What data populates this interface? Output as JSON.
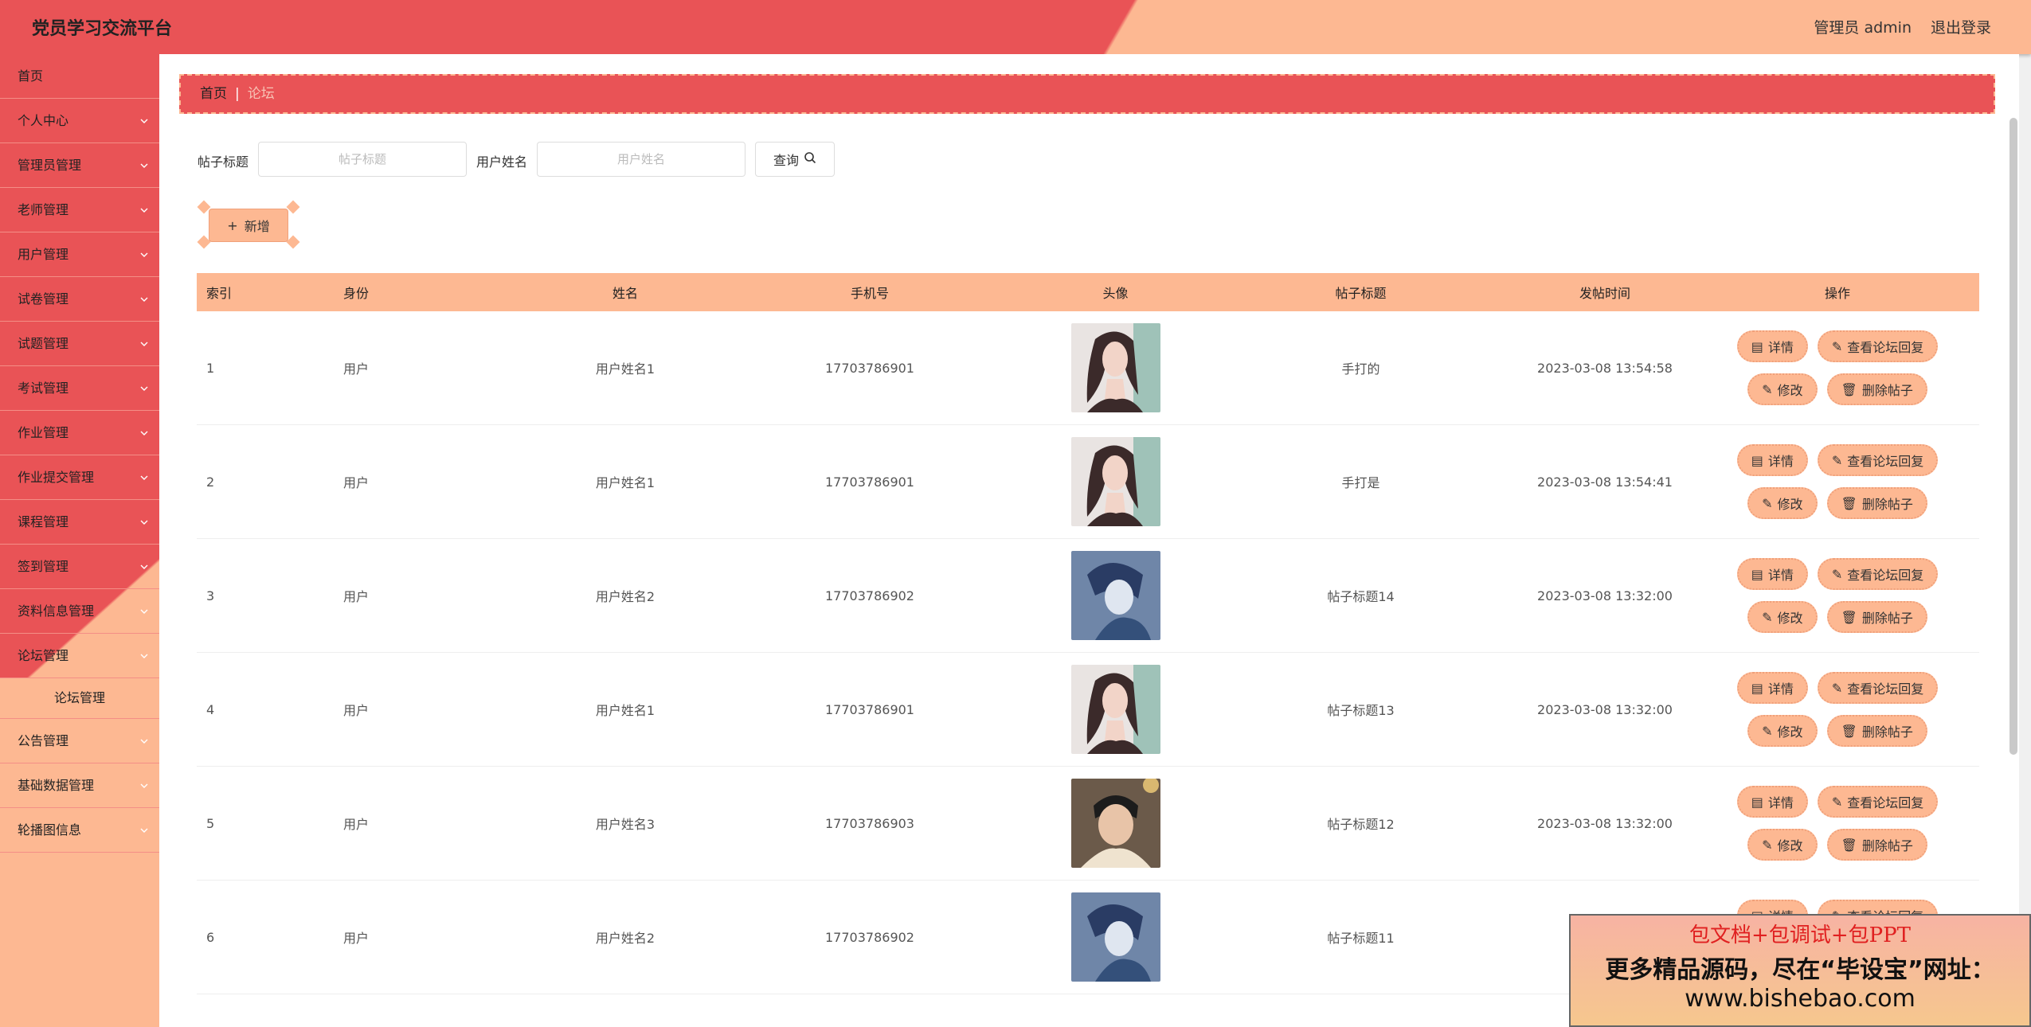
{
  "header": {
    "title": "党员学习交流平台",
    "user": "管理员 admin",
    "logout": "退出登录"
  },
  "sidebar": {
    "items": [
      {
        "label": "首页"
      },
      {
        "label": "个人中心"
      },
      {
        "label": "管理员管理"
      },
      {
        "label": "老师管理"
      },
      {
        "label": "用户管理"
      },
      {
        "label": "试卷管理"
      },
      {
        "label": "试题管理"
      },
      {
        "label": "考试管理"
      },
      {
        "label": "作业管理"
      },
      {
        "label": "作业提交管理"
      },
      {
        "label": "课程管理"
      },
      {
        "label": "签到管理"
      },
      {
        "label": "资料信息管理"
      },
      {
        "label": "论坛管理"
      }
    ],
    "submenu": "论坛管理",
    "items_after": [
      {
        "label": "公告管理"
      },
      {
        "label": "基础数据管理"
      },
      {
        "label": "轮播图信息"
      }
    ]
  },
  "breadcrumb": {
    "home": "首页",
    "current": "论坛"
  },
  "search": {
    "title_label": "帖子标题",
    "title_placeholder": "帖子标题",
    "name_label": "用户姓名",
    "name_placeholder": "用户姓名",
    "query": "查询"
  },
  "add_button": "新增",
  "table": {
    "headers": [
      "索引",
      "身份",
      "姓名",
      "手机号",
      "头像",
      "帖子标题",
      "发帖时间",
      "操作"
    ],
    "rows": [
      {
        "idx": "1",
        "role": "用户",
        "name": "用户姓名1",
        "phone": "17703786901",
        "avatar": "female",
        "title": "手打的",
        "time": "2023-03-08 13:54:58"
      },
      {
        "idx": "2",
        "role": "用户",
        "name": "用户姓名1",
        "phone": "17703786901",
        "avatar": "female",
        "title": "手打是",
        "time": "2023-03-08 13:54:41"
      },
      {
        "idx": "3",
        "role": "用户",
        "name": "用户姓名2",
        "phone": "17703786902",
        "avatar": "blue",
        "title": "帖子标题14",
        "time": "2023-03-08 13:32:00"
      },
      {
        "idx": "4",
        "role": "用户",
        "name": "用户姓名1",
        "phone": "17703786901",
        "avatar": "female",
        "title": "帖子标题13",
        "time": "2023-03-08 13:32:00"
      },
      {
        "idx": "5",
        "role": "用户",
        "name": "用户姓名3",
        "phone": "17703786903",
        "avatar": "photo",
        "title": "帖子标题12",
        "time": "2023-03-08 13:32:00"
      },
      {
        "idx": "6",
        "role": "用户",
        "name": "用户姓名2",
        "phone": "17703786902",
        "avatar": "blue",
        "title": "帖子标题11",
        "time": "2023-0"
      }
    ],
    "ops": {
      "detail": "详情",
      "view_reply": "查看论坛回复",
      "edit": "修改",
      "delete": "删除帖子"
    }
  },
  "watermark": {
    "line1": "包文档+包调试+包PPT",
    "line2": "更多精品源码，尽在“毕设宝”网址：",
    "line3": "www.bishebao.com"
  },
  "colors": {
    "primary": "#e95356",
    "accent": "#fdb892"
  }
}
